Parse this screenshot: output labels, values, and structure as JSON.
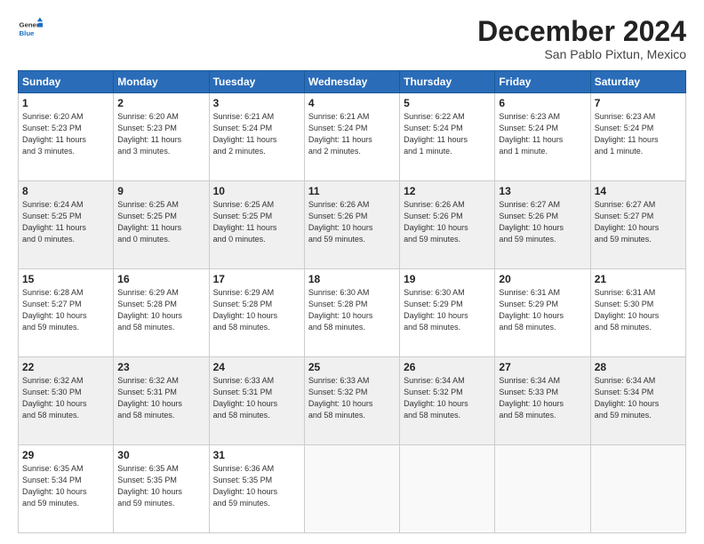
{
  "logo": {
    "general": "General",
    "blue": "Blue"
  },
  "header": {
    "month": "December 2024",
    "location": "San Pablo Pixtun, Mexico"
  },
  "days_of_week": [
    "Sunday",
    "Monday",
    "Tuesday",
    "Wednesday",
    "Thursday",
    "Friday",
    "Saturday"
  ],
  "weeks": [
    [
      {
        "day": "1",
        "info": "Sunrise: 6:20 AM\nSunset: 5:23 PM\nDaylight: 11 hours\nand 3 minutes."
      },
      {
        "day": "2",
        "info": "Sunrise: 6:20 AM\nSunset: 5:23 PM\nDaylight: 11 hours\nand 3 minutes."
      },
      {
        "day": "3",
        "info": "Sunrise: 6:21 AM\nSunset: 5:24 PM\nDaylight: 11 hours\nand 2 minutes."
      },
      {
        "day": "4",
        "info": "Sunrise: 6:21 AM\nSunset: 5:24 PM\nDaylight: 11 hours\nand 2 minutes."
      },
      {
        "day": "5",
        "info": "Sunrise: 6:22 AM\nSunset: 5:24 PM\nDaylight: 11 hours\nand 1 minute."
      },
      {
        "day": "6",
        "info": "Sunrise: 6:23 AM\nSunset: 5:24 PM\nDaylight: 11 hours\nand 1 minute."
      },
      {
        "day": "7",
        "info": "Sunrise: 6:23 AM\nSunset: 5:24 PM\nDaylight: 11 hours\nand 1 minute."
      }
    ],
    [
      {
        "day": "8",
        "info": "Sunrise: 6:24 AM\nSunset: 5:25 PM\nDaylight: 11 hours\nand 0 minutes."
      },
      {
        "day": "9",
        "info": "Sunrise: 6:25 AM\nSunset: 5:25 PM\nDaylight: 11 hours\nand 0 minutes."
      },
      {
        "day": "10",
        "info": "Sunrise: 6:25 AM\nSunset: 5:25 PM\nDaylight: 11 hours\nand 0 minutes."
      },
      {
        "day": "11",
        "info": "Sunrise: 6:26 AM\nSunset: 5:26 PM\nDaylight: 10 hours\nand 59 minutes."
      },
      {
        "day": "12",
        "info": "Sunrise: 6:26 AM\nSunset: 5:26 PM\nDaylight: 10 hours\nand 59 minutes."
      },
      {
        "day": "13",
        "info": "Sunrise: 6:27 AM\nSunset: 5:26 PM\nDaylight: 10 hours\nand 59 minutes."
      },
      {
        "day": "14",
        "info": "Sunrise: 6:27 AM\nSunset: 5:27 PM\nDaylight: 10 hours\nand 59 minutes."
      }
    ],
    [
      {
        "day": "15",
        "info": "Sunrise: 6:28 AM\nSunset: 5:27 PM\nDaylight: 10 hours\nand 59 minutes."
      },
      {
        "day": "16",
        "info": "Sunrise: 6:29 AM\nSunset: 5:28 PM\nDaylight: 10 hours\nand 58 minutes."
      },
      {
        "day": "17",
        "info": "Sunrise: 6:29 AM\nSunset: 5:28 PM\nDaylight: 10 hours\nand 58 minutes."
      },
      {
        "day": "18",
        "info": "Sunrise: 6:30 AM\nSunset: 5:28 PM\nDaylight: 10 hours\nand 58 minutes."
      },
      {
        "day": "19",
        "info": "Sunrise: 6:30 AM\nSunset: 5:29 PM\nDaylight: 10 hours\nand 58 minutes."
      },
      {
        "day": "20",
        "info": "Sunrise: 6:31 AM\nSunset: 5:29 PM\nDaylight: 10 hours\nand 58 minutes."
      },
      {
        "day": "21",
        "info": "Sunrise: 6:31 AM\nSunset: 5:30 PM\nDaylight: 10 hours\nand 58 minutes."
      }
    ],
    [
      {
        "day": "22",
        "info": "Sunrise: 6:32 AM\nSunset: 5:30 PM\nDaylight: 10 hours\nand 58 minutes."
      },
      {
        "day": "23",
        "info": "Sunrise: 6:32 AM\nSunset: 5:31 PM\nDaylight: 10 hours\nand 58 minutes."
      },
      {
        "day": "24",
        "info": "Sunrise: 6:33 AM\nSunset: 5:31 PM\nDaylight: 10 hours\nand 58 minutes."
      },
      {
        "day": "25",
        "info": "Sunrise: 6:33 AM\nSunset: 5:32 PM\nDaylight: 10 hours\nand 58 minutes."
      },
      {
        "day": "26",
        "info": "Sunrise: 6:34 AM\nSunset: 5:32 PM\nDaylight: 10 hours\nand 58 minutes."
      },
      {
        "day": "27",
        "info": "Sunrise: 6:34 AM\nSunset: 5:33 PM\nDaylight: 10 hours\nand 58 minutes."
      },
      {
        "day": "28",
        "info": "Sunrise: 6:34 AM\nSunset: 5:34 PM\nDaylight: 10 hours\nand 59 minutes."
      }
    ],
    [
      {
        "day": "29",
        "info": "Sunrise: 6:35 AM\nSunset: 5:34 PM\nDaylight: 10 hours\nand 59 minutes."
      },
      {
        "day": "30",
        "info": "Sunrise: 6:35 AM\nSunset: 5:35 PM\nDaylight: 10 hours\nand 59 minutes."
      },
      {
        "day": "31",
        "info": "Sunrise: 6:36 AM\nSunset: 5:35 PM\nDaylight: 10 hours\nand 59 minutes."
      },
      {
        "day": "",
        "info": ""
      },
      {
        "day": "",
        "info": ""
      },
      {
        "day": "",
        "info": ""
      },
      {
        "day": "",
        "info": ""
      }
    ]
  ]
}
